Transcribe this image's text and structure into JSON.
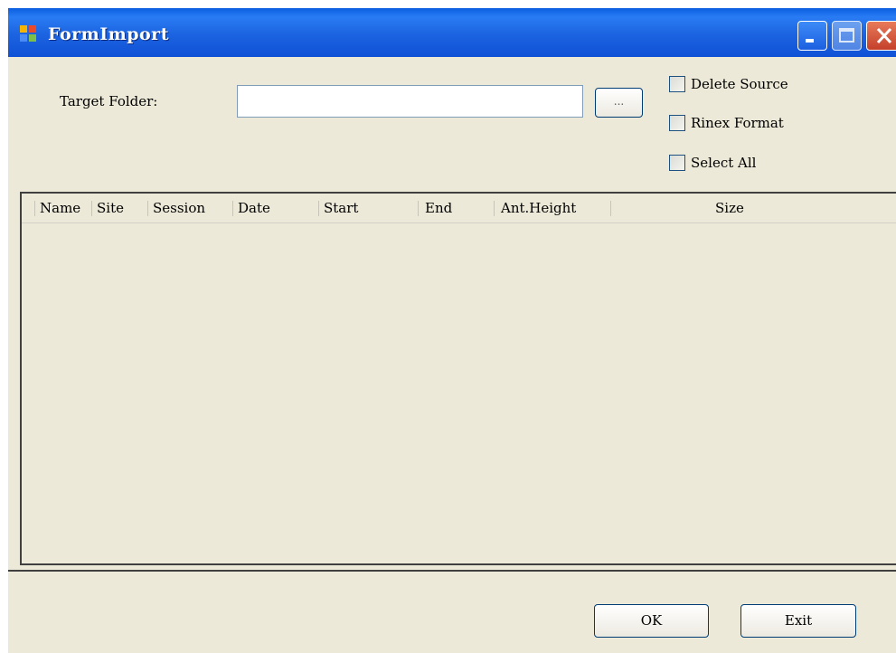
{
  "window": {
    "title": "FormImport"
  },
  "form": {
    "target_folder_label": "Target Folder:",
    "target_folder_value": "",
    "browse_label": "...",
    "delete_source_label": "Delete Source",
    "delete_source_checked": false,
    "rinex_format_label": "Rinex Format",
    "rinex_format_checked": false,
    "select_all_label": "Select All",
    "select_all_checked": false
  },
  "list": {
    "columns": [
      "Name",
      "Site",
      "Session",
      "Date",
      "Start",
      "End",
      "Ant.Height",
      "Size"
    ],
    "rows": []
  },
  "buttons": {
    "ok_label": "OK",
    "exit_label": "Exit"
  },
  "colors": {
    "titlebar": "#1b63e0",
    "window_bg": "#ece9d8"
  }
}
